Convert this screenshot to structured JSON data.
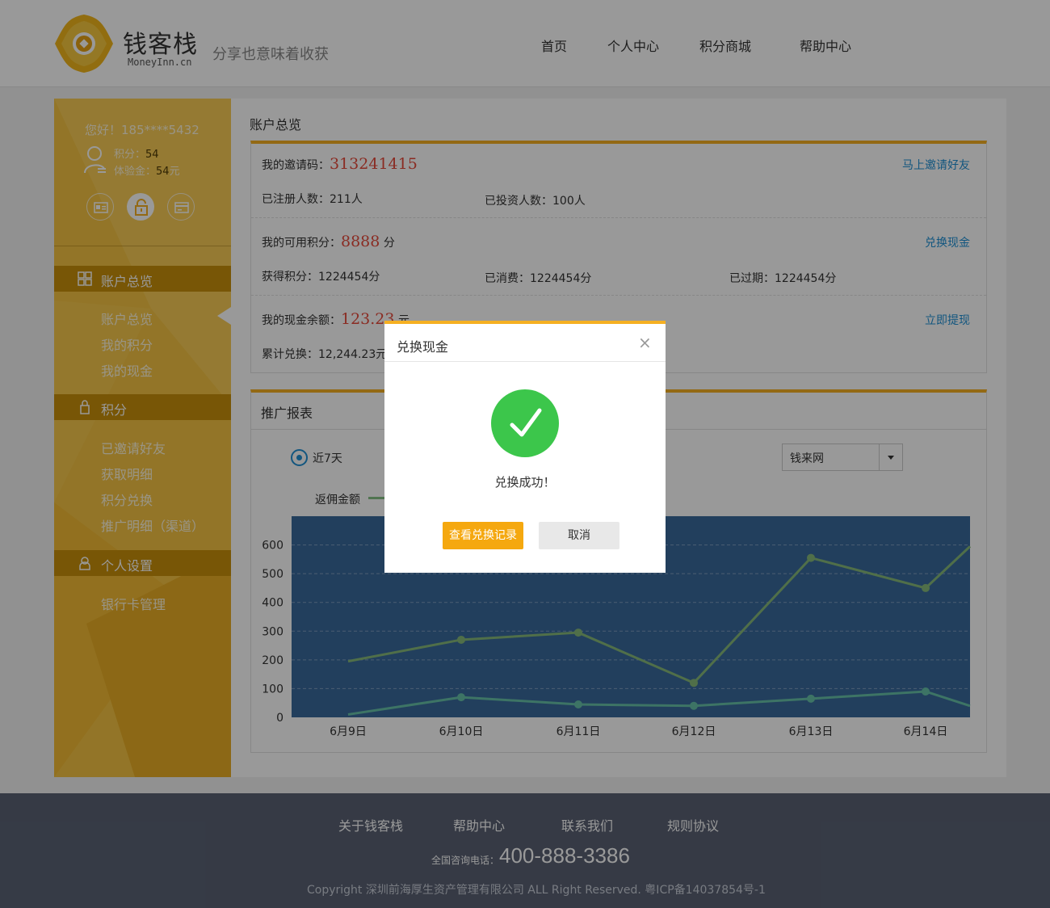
{
  "header": {
    "logo_cn": "钱客栈",
    "logo_en": "MoneyInn.cn",
    "slogan": "分享也意味着收获",
    "nav": [
      "首页",
      "个人中心",
      "积分商城",
      "帮助中心"
    ]
  },
  "sidebar": {
    "greeting": "您好！185****5432",
    "points_label": "积分：",
    "points_value": "54",
    "trial_label": "体验金：",
    "trial_value": "54",
    "trial_unit": "元",
    "icons": [
      "id-card-icon",
      "unlock-icon",
      "bank-card-icon"
    ],
    "sections": [
      {
        "title": "账户总览",
        "icon": "grid-icon",
        "items": [
          "账户总览",
          "我的积分",
          "我的现金"
        ]
      },
      {
        "title": "积分",
        "icon": "bag-icon",
        "items": [
          "已邀请好友",
          "获取明细",
          "积分兑换",
          "推广明细（渠道）"
        ]
      },
      {
        "title": "个人设置",
        "icon": "user-icon",
        "items": [
          "银行卡管理"
        ]
      }
    ]
  },
  "overview": {
    "title": "账户总览",
    "invite_code_label": "我的邀请码：",
    "invite_code": "313241415",
    "invite_link": "马上邀请好友",
    "registered": "已注册人数：211人",
    "invested": "已投资人数：100人",
    "points_label": "我的可用积分：",
    "points_value": "8888",
    "points_unit": "分",
    "exchange_link": "兑换现金",
    "earned": "获得积分：1224454分",
    "consumed": "已消费：1224454分",
    "expired": "已过期：1224454分",
    "cash_label": "我的现金余额：",
    "cash_value": "123.23",
    "cash_unit": "元",
    "withdraw_link": "立即提现",
    "total_exchanged": "累计兑换：12,244.23元"
  },
  "report": {
    "title": "推广报表",
    "radio_label": "近7天",
    "select_value": "钱来网",
    "legend_visible": "返佣金额"
  },
  "chart_data": {
    "type": "line",
    "x": [
      "6月9日",
      "6月10日",
      "6月11日",
      "6月12日",
      "6月13日",
      "6月14日",
      ""
    ],
    "tick_labels": [
      "6月9日",
      "6月10日",
      "6月11日",
      "6月12日",
      "6月13日",
      "6月14日"
    ],
    "yticks": [
      0,
      100,
      200,
      300,
      400,
      500,
      600
    ],
    "ylim": [
      0,
      700
    ],
    "series": [
      {
        "name": "",
        "color": "#86b97a",
        "values": [
          195,
          270,
          295,
          120,
          555,
          450,
          595
        ]
      },
      {
        "name": "",
        "color": "#66c1a8",
        "values": [
          10,
          70,
          45,
          40,
          65,
          90,
          40
        ]
      }
    ],
    "background": "#3a6a9c",
    "grid": true
  },
  "footer": {
    "links": [
      "关于钱客栈",
      "帮助中心",
      "联系我们",
      "规则协议"
    ],
    "tel_label": "全国咨询电话：",
    "tel": "400-888-3386",
    "copyright": "Copyright  深圳前海厚生资产管理有限公司  ALL Right Reserved. 粤ICP备14037854号-1"
  },
  "dialog": {
    "title": "兑换现金",
    "close": "×",
    "message": "兑换成功！",
    "primary_button": "查看兑换记录",
    "cancel_button": "取消"
  },
  "colors": {
    "accent": "#f5b022",
    "sidebar": "#f6c443",
    "link": "#1e8fd4",
    "highlight": "#e64a3b"
  }
}
